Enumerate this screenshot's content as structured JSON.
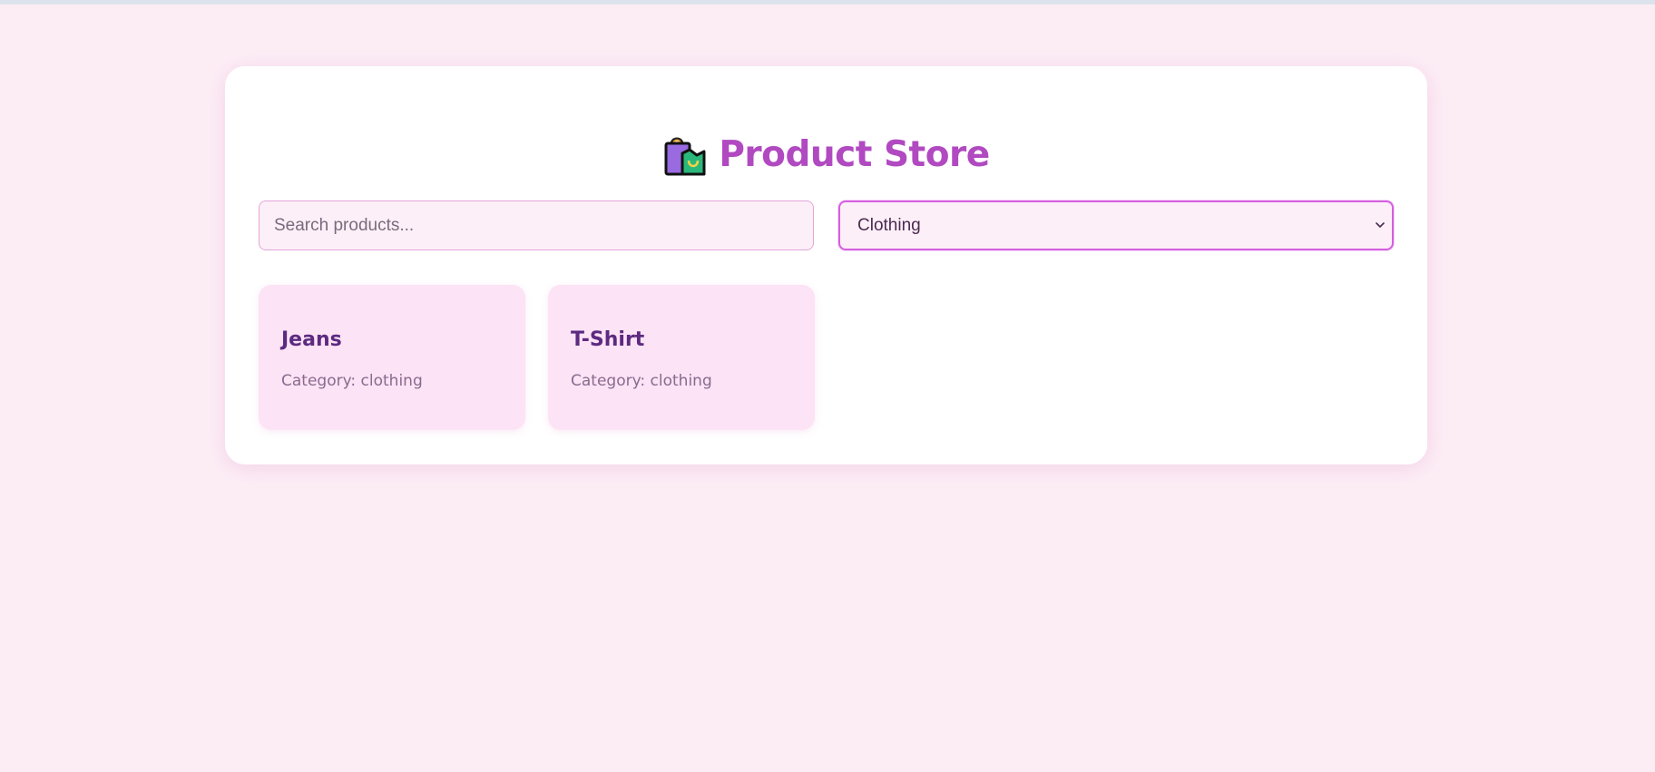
{
  "header": {
    "icon": "shopping-bags-icon",
    "title": "Product Store"
  },
  "controls": {
    "search_placeholder": "Search products...",
    "search_value": "",
    "category_selected": "Clothing"
  },
  "products": [
    {
      "name": "Jeans",
      "category_text": "Category: clothing"
    },
    {
      "name": "T-Shirt",
      "category_text": "Category: clothing"
    }
  ],
  "colors": {
    "page_bg": "#fcedf5",
    "title": "#b149c1",
    "product_card_bg": "#fce3f5",
    "product_name": "#5c2a80",
    "focus_border": "#d45fe0"
  }
}
